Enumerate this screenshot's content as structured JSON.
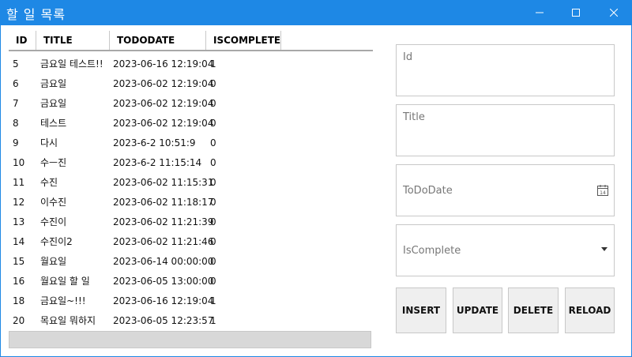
{
  "window": {
    "title": "할 일 목록",
    "accent": "#1e88e5"
  },
  "grid": {
    "columns": [
      "ID",
      "TITLE",
      "TODODATE",
      "ISCOMPLETE"
    ],
    "rows": [
      {
        "id": "5",
        "title": "금요일 테스트!!",
        "date": "2023-06-16 12:19:04",
        "complete": "1"
      },
      {
        "id": "6",
        "title": "금요일",
        "date": "2023-06-02 12:19:04",
        "complete": "0"
      },
      {
        "id": "7",
        "title": "금요일",
        "date": "2023-06-02 12:19:04",
        "complete": "0"
      },
      {
        "id": "8",
        "title": "테스트",
        "date": "2023-06-02 12:19:04",
        "complete": "0"
      },
      {
        "id": "9",
        "title": "다시",
        "date": "2023-6-2 10:51:9",
        "complete": "0"
      },
      {
        "id": "10",
        "title": "수ㅡ진",
        "date": "2023-6-2 11:15:14",
        "complete": "0"
      },
      {
        "id": "11",
        "title": "수진",
        "date": "2023-06-02 11:15:31",
        "complete": "0"
      },
      {
        "id": "12",
        "title": "이수진",
        "date": "2023-06-02 11:18:17",
        "complete": "0"
      },
      {
        "id": "13",
        "title": "수진이",
        "date": "2023-06-02 11:21:39",
        "complete": "0"
      },
      {
        "id": "14",
        "title": "수진이2",
        "date": "2023-06-02 11:21:46",
        "complete": "0"
      },
      {
        "id": "15",
        "title": "월요일",
        "date": "2023-06-14 00:00:00",
        "complete": "0"
      },
      {
        "id": "16",
        "title": "월요일 할 일",
        "date": "2023-06-05 13:00:00",
        "complete": "0"
      },
      {
        "id": "18",
        "title": "금요일~!!!",
        "date": "2023-06-16 12:19:04",
        "complete": "1"
      },
      {
        "id": "20",
        "title": "목요일 뭐하지",
        "date": "2023-06-05 12:23:57",
        "complete": "1"
      }
    ]
  },
  "form": {
    "id_placeholder": "Id",
    "title_placeholder": "Title",
    "date_placeholder": "ToDoDate",
    "complete_placeholder": "IsComplete",
    "calendar_icon": "calendar-icon",
    "dropdown_icon": "dropdown-arrow-icon"
  },
  "buttons": {
    "insert": "INSERT",
    "update": "UPDATE",
    "delete": "DELETE",
    "reload": "RELOAD"
  }
}
